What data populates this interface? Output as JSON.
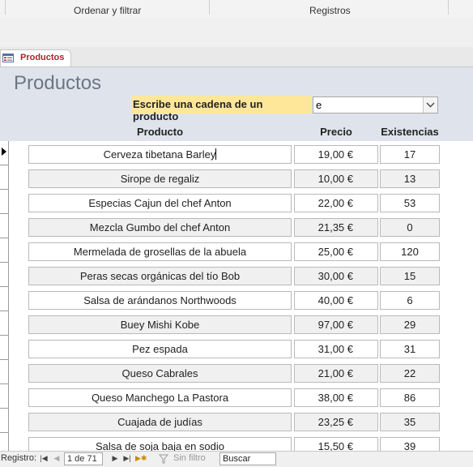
{
  "ribbon": {
    "groups": [
      "Ordenar y filtrar",
      "Registros"
    ]
  },
  "tab": {
    "label": "Productos",
    "icon": "form-icon"
  },
  "form": {
    "title": "Productos",
    "search_label": "Escribe una cadena de un producto",
    "search_value": "e"
  },
  "columns": {
    "product": "Producto",
    "price": "Precio",
    "stock": "Existencias"
  },
  "rows": [
    {
      "product": "Cerveza tibetana Barley",
      "price": "19,00 €",
      "stock": "17"
    },
    {
      "product": "Sirope de regaliz",
      "price": "10,00 €",
      "stock": "13"
    },
    {
      "product": "Especias Cajun del chef Anton",
      "price": "22,00 €",
      "stock": "53"
    },
    {
      "product": "Mezcla Gumbo del chef Anton",
      "price": "21,35 €",
      "stock": "0"
    },
    {
      "product": "Mermelada de grosellas de la abuela",
      "price": "25,00 €",
      "stock": "120"
    },
    {
      "product": "Peras secas orgánicas del tío Bob",
      "price": "30,00 €",
      "stock": "15"
    },
    {
      "product": "Salsa de arándanos Northwoods",
      "price": "40,00 €",
      "stock": "6"
    },
    {
      "product": "Buey Mishi Kobe",
      "price": "97,00 €",
      "stock": "29"
    },
    {
      "product": "Pez espada",
      "price": "31,00 €",
      "stock": "31"
    },
    {
      "product": "Queso Cabrales",
      "price": "21,00 €",
      "stock": "22"
    },
    {
      "product": "Queso Manchego La Pastora",
      "price": "38,00 €",
      "stock": "86"
    },
    {
      "product": "Cuajada de judías",
      "price": "23,25 €",
      "stock": "35"
    },
    {
      "product": "Salsa de soja baja en sodio",
      "price": "15,50 €",
      "stock": "39"
    }
  ],
  "navigation": {
    "label": "Registro:",
    "record_position": "1 de 71",
    "filter_label": "Sin filtro",
    "search_placeholder": "Buscar"
  },
  "colors": {
    "header_background": "#dfe4ec",
    "label_highlight": "#ffe79a",
    "tab_text": "#a4262c"
  }
}
